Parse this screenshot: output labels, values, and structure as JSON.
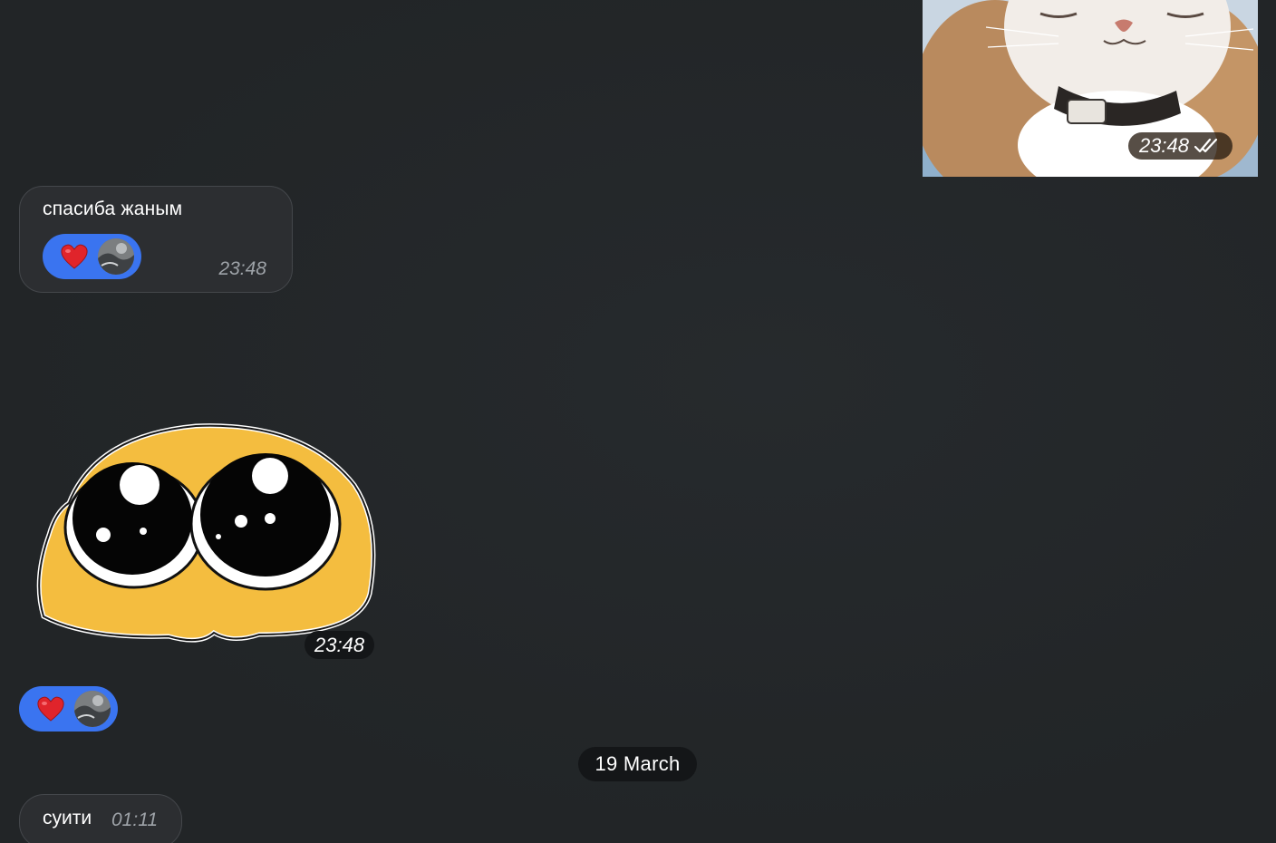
{
  "messages": {
    "photo": {
      "time": "23:48",
      "status_icon": "double-check-icon"
    },
    "text_1": {
      "text": "спасиба жаным",
      "time": "23:48",
      "reaction": {
        "emoji": "heart-icon",
        "color": "#3a74f0"
      }
    },
    "sticker": {
      "time": "23:48",
      "reaction": {
        "emoji": "heart-icon",
        "color": "#3a74f0"
      }
    },
    "date_separator": "19 March",
    "text_2": {
      "text": "суити",
      "time": "01:11"
    }
  },
  "colors": {
    "background": "#24272a",
    "incoming_bubble": "#2c2e31",
    "reaction_pill": "#3a74f0",
    "heart": "#e0242b"
  }
}
